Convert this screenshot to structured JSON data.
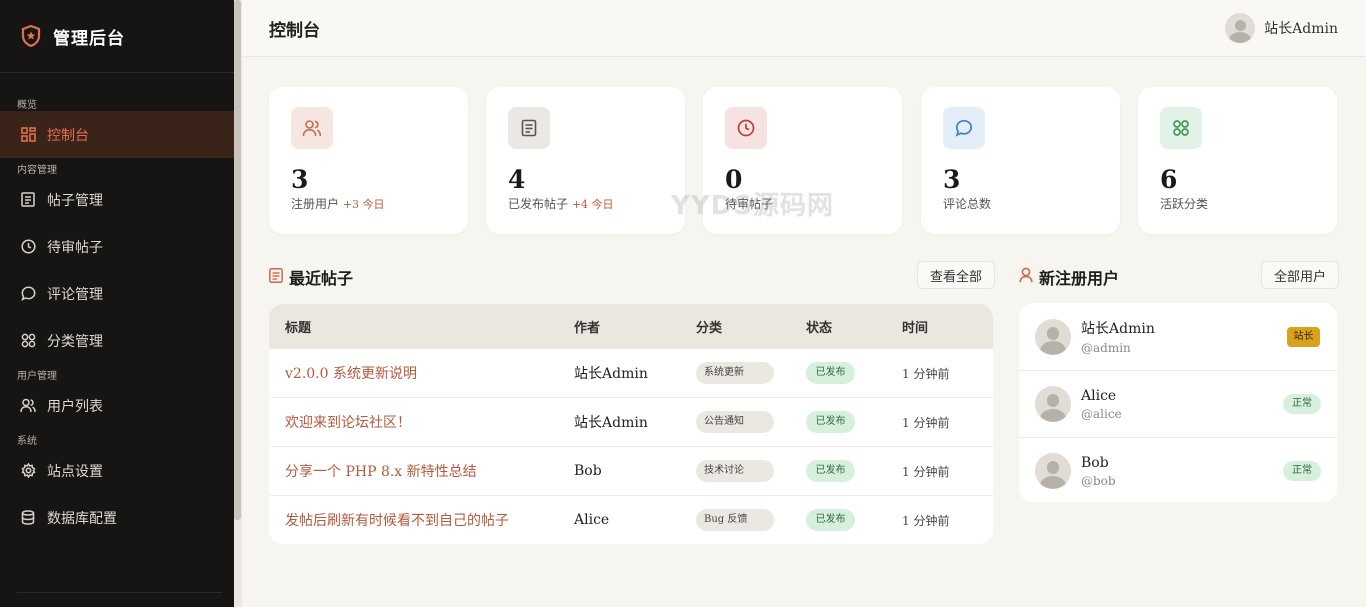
{
  "brand": {
    "title": "管理后台"
  },
  "sidebar": {
    "sections": [
      {
        "label": "概览"
      },
      {
        "label": "内容管理"
      },
      {
        "label": "用户管理"
      },
      {
        "label": "系统"
      }
    ],
    "items": [
      {
        "label": "控制台",
        "icon": "dashboard-icon",
        "active": true
      },
      {
        "label": "帖子管理",
        "icon": "posts-icon"
      },
      {
        "label": "待审帖子",
        "icon": "clock-icon"
      },
      {
        "label": "评论管理",
        "icon": "comment-icon"
      },
      {
        "label": "分类管理",
        "icon": "category-icon"
      },
      {
        "label": "用户列表",
        "icon": "users-icon"
      },
      {
        "label": "站点设置",
        "icon": "gear-icon"
      },
      {
        "label": "数据库配置",
        "icon": "database-icon"
      }
    ]
  },
  "header": {
    "title": "控制台",
    "user_name": "站长Admin"
  },
  "stats": [
    {
      "value": "3",
      "label": "注册用户",
      "delta": "+3 今日",
      "icon": "users-icon",
      "color": "#c86a4c",
      "bg": "#f6e6e1"
    },
    {
      "value": "4",
      "label": "已发布帖子",
      "delta": "+4 今日",
      "icon": "document-icon",
      "color": "#555555",
      "bg": "#ebe8e3"
    },
    {
      "value": "0",
      "label": "待审帖子",
      "delta": "",
      "icon": "clock-icon",
      "color": "#b8413f",
      "bg": "#f6e2e1"
    },
    {
      "value": "3",
      "label": "评论总数",
      "delta": "",
      "icon": "chat-icon",
      "color": "#3b82c4",
      "bg": "#e4eef8"
    },
    {
      "value": "6",
      "label": "活跃分类",
      "delta": "",
      "icon": "grid-icon",
      "color": "#3e9a5b",
      "bg": "#e2f2e6"
    }
  ],
  "recent_posts": {
    "title": "最近帖子",
    "view_all": "查看全部",
    "columns": [
      "标题",
      "作者",
      "分类",
      "状态",
      "时间"
    ],
    "rows": [
      {
        "title": "v2.0.0 系统更新说明",
        "author": "站长Admin",
        "category": "系统更新",
        "status": "已发布",
        "time": "1 分钟前"
      },
      {
        "title": "欢迎来到论坛社区！",
        "author": "站长Admin",
        "category": "公告通知",
        "status": "已发布",
        "time": "1 分钟前"
      },
      {
        "title": "分享一个 PHP 8.x 新特性总结",
        "author": "Bob",
        "category": "技术讨论",
        "status": "已发布",
        "time": "1 分钟前"
      },
      {
        "title": "发帖后刷新有时候看不到自己的帖子",
        "author": "Alice",
        "category": "Bug 反馈",
        "status": "已发布",
        "time": "1 分钟前"
      }
    ]
  },
  "new_users": {
    "title": "新注册用户",
    "view_all": "全部用户",
    "rows": [
      {
        "name": "站长Admin",
        "handle": "@admin",
        "badge": "站长",
        "badge_type": "admin"
      },
      {
        "name": "Alice",
        "handle": "@alice",
        "badge": "正常",
        "badge_type": "normal"
      },
      {
        "name": "Bob",
        "handle": "@bob",
        "badge": "正常",
        "badge_type": "normal"
      }
    ]
  },
  "watermark": "YYDS源码网"
}
